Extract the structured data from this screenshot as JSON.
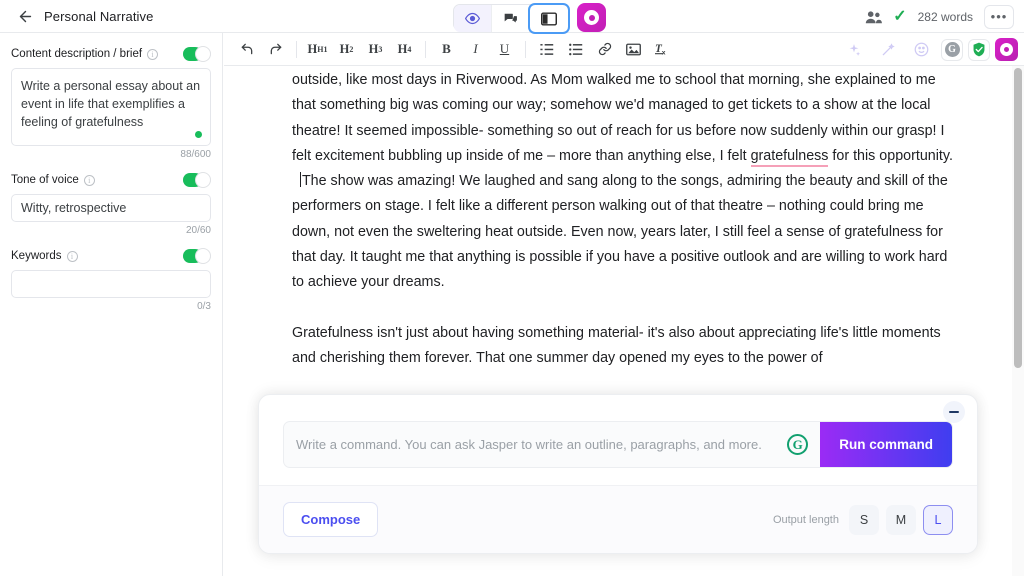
{
  "topbar": {
    "back_icon": "arrow-left-icon",
    "doc_title": "Personal Narrative",
    "view_buttons": [
      {
        "name": "preview-icon",
        "label": ""
      },
      {
        "name": "comments-icon",
        "label": ""
      },
      {
        "name": "split-view-icon",
        "label": ""
      }
    ],
    "jasper_label": "",
    "collaborators_icon": "people-icon",
    "saved_check": "✓",
    "word_count": "282 words",
    "more_label": "•••"
  },
  "sidebar": {
    "fields": [
      {
        "label": "Content description / brief",
        "toggle_on": true,
        "value": "Write a personal essay about an event in life that exemplifies a feeling of gratefulness",
        "placeholder": "",
        "counter": "88/600",
        "has_status_dot": true
      },
      {
        "label": "Tone of voice",
        "toggle_on": true,
        "value": "Witty, retrospective",
        "placeholder": "",
        "counter": "20/60",
        "has_status_dot": false
      },
      {
        "label": "Keywords",
        "toggle_on": true,
        "value": "",
        "placeholder": "",
        "counter": "0/3",
        "has_status_dot": false
      }
    ]
  },
  "editor_toolbar": {
    "undo": "undo-icon",
    "redo": "redo-icon",
    "headings": [
      "H1",
      "H2",
      "H3",
      "H4"
    ],
    "bold": "B",
    "italic": "I",
    "underline": "U",
    "ordered_list": "ordered-list-icon",
    "bullet_list": "bullet-list-icon",
    "link": "link-icon",
    "image": "image-icon",
    "clear_format": "clear-formatting-icon",
    "right_icons": [
      "sparkle-icon",
      "magic-wand-icon",
      "emoji-icon",
      "grammarly-icon",
      "plagiarism-shield-icon",
      "jasper-icon"
    ],
    "grammarly_letter": "G"
  },
  "document": {
    "paragraph1": {
      "part1": "outside, like most days in Riverwood. As Mom walked me to school that morning, she explained to me that something big was coming our way; somehow we'd managed to get tickets to a show at the local theatre! It seemed impossible- something so out of reach for us before now suddenly within our grasp! I felt excitement bubbling up inside of me – more than anything else, I felt ",
      "misspelled": "gratefulness",
      "part2": " for this opportunity."
    },
    "paragraph2": "The show was amazing! We laughed and sang along to the songs, admiring the beauty and skill of the performers on stage. I felt like a different person walking out of that theatre – nothing could bring me down, not even the sweltering heat outside. Even now, years later, I still feel a sense of gratefulness for that day. It taught me that anything is possible if you have a positive outlook and are willing to work hard to achieve your dreams.",
    "paragraph3": "Gratefulness isn't just about having something material- it's also about appreciating life's little moments and cherishing them forever. That one summer day opened my eyes to the power of"
  },
  "command_panel": {
    "minimize_label": "",
    "input_placeholder": "Write a command. You can ask Jasper to write an outline, paragraphs, and more.",
    "input_value": "",
    "grammarly_letter": "G",
    "run_label": "Run command",
    "tips_icon": "lightbulb-icon",
    "compose_label": "Compose",
    "output_length_label": "Output length",
    "length_options": [
      "S",
      "M",
      "L"
    ],
    "length_selected": "L"
  },
  "colors": {
    "accent_purple": "#4b4ef0",
    "jasper_magenta": "#c11fb5",
    "toggle_green": "#18bd5b",
    "spell_error": "#f5a0b8",
    "run_gradient_start": "#9b2bf5",
    "run_gradient_end": "#3f3ef0"
  }
}
